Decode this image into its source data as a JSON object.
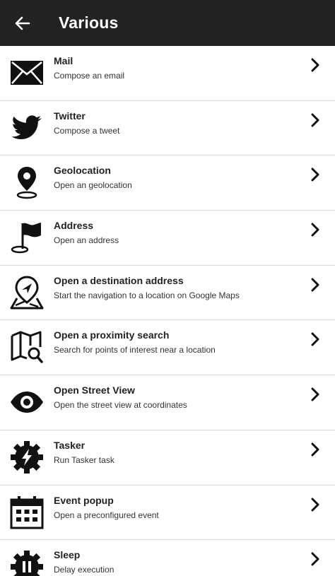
{
  "app_bar": {
    "title": "Various",
    "back_icon": "arrow-left-icon"
  },
  "items": [
    {
      "key": "mail",
      "title": "Mail",
      "subtitle": "Compose an email",
      "icon": "mail-icon"
    },
    {
      "key": "twitter",
      "title": "Twitter",
      "subtitle": "Compose a tweet",
      "icon": "twitter-icon"
    },
    {
      "key": "geolocation",
      "title": "Geolocation",
      "subtitle": "Open an geolocation",
      "icon": "map-pin-icon"
    },
    {
      "key": "address",
      "title": "Address",
      "subtitle": "Open an address",
      "icon": "flag-pin-icon"
    },
    {
      "key": "destination",
      "title": "Open a destination address",
      "subtitle": "Start the navigation to a location on Google Maps",
      "icon": "navigation-map-icon"
    },
    {
      "key": "proximity",
      "title": "Open a proximity search",
      "subtitle": "Search for points of interest near a location",
      "icon": "map-search-icon"
    },
    {
      "key": "streetview",
      "title": "Open Street View",
      "subtitle": "Open the street view at coordinates",
      "icon": "eye-icon"
    },
    {
      "key": "tasker",
      "title": "Tasker",
      "subtitle": "Run Tasker task",
      "icon": "tasker-gear-icon"
    },
    {
      "key": "event",
      "title": "Event popup",
      "subtitle": "Open a preconfigured event",
      "icon": "calendar-icon"
    },
    {
      "key": "sleep",
      "title": "Sleep",
      "subtitle": "Delay execution",
      "icon": "pause-gear-icon"
    }
  ],
  "chevron_icon": "chevron-right-icon",
  "colors": {
    "app_bar_bg": "#222222",
    "app_bar_text": "#ffffff",
    "divider": "#d9d9d9",
    "icon": "#111111"
  }
}
